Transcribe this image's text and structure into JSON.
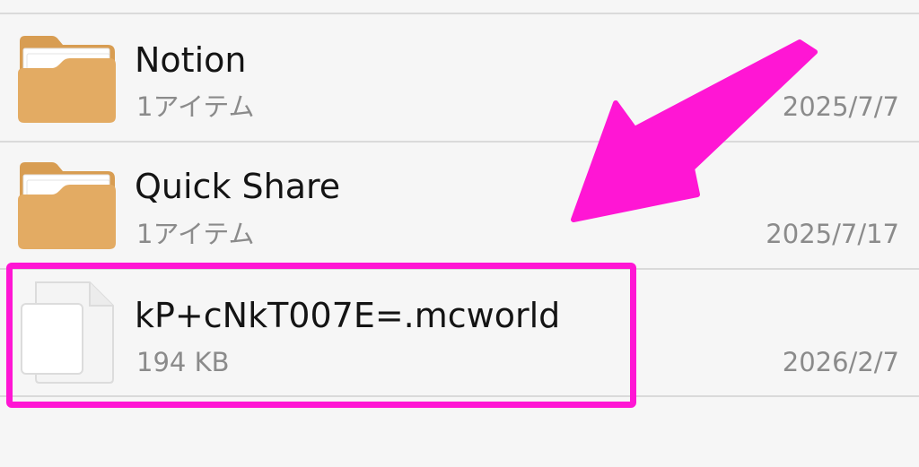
{
  "file_list": {
    "items": [
      {
        "name": "Notion",
        "detail": "1アイテム",
        "date": "2025/7/7",
        "type": "folder",
        "icon": "folder-icon"
      },
      {
        "name": "Quick Share",
        "detail": "1アイテム",
        "date": "2025/7/17",
        "type": "folder",
        "icon": "folder-icon"
      },
      {
        "name": "kP+cNkT007E=.mcworld",
        "detail": "194 KB",
        "date": "2026/2/7",
        "type": "file",
        "icon": "file-icon"
      }
    ]
  },
  "annotation": {
    "color": "#ff16d4",
    "highlighted_item": "kP+cNkT007E=.mcworld"
  }
}
